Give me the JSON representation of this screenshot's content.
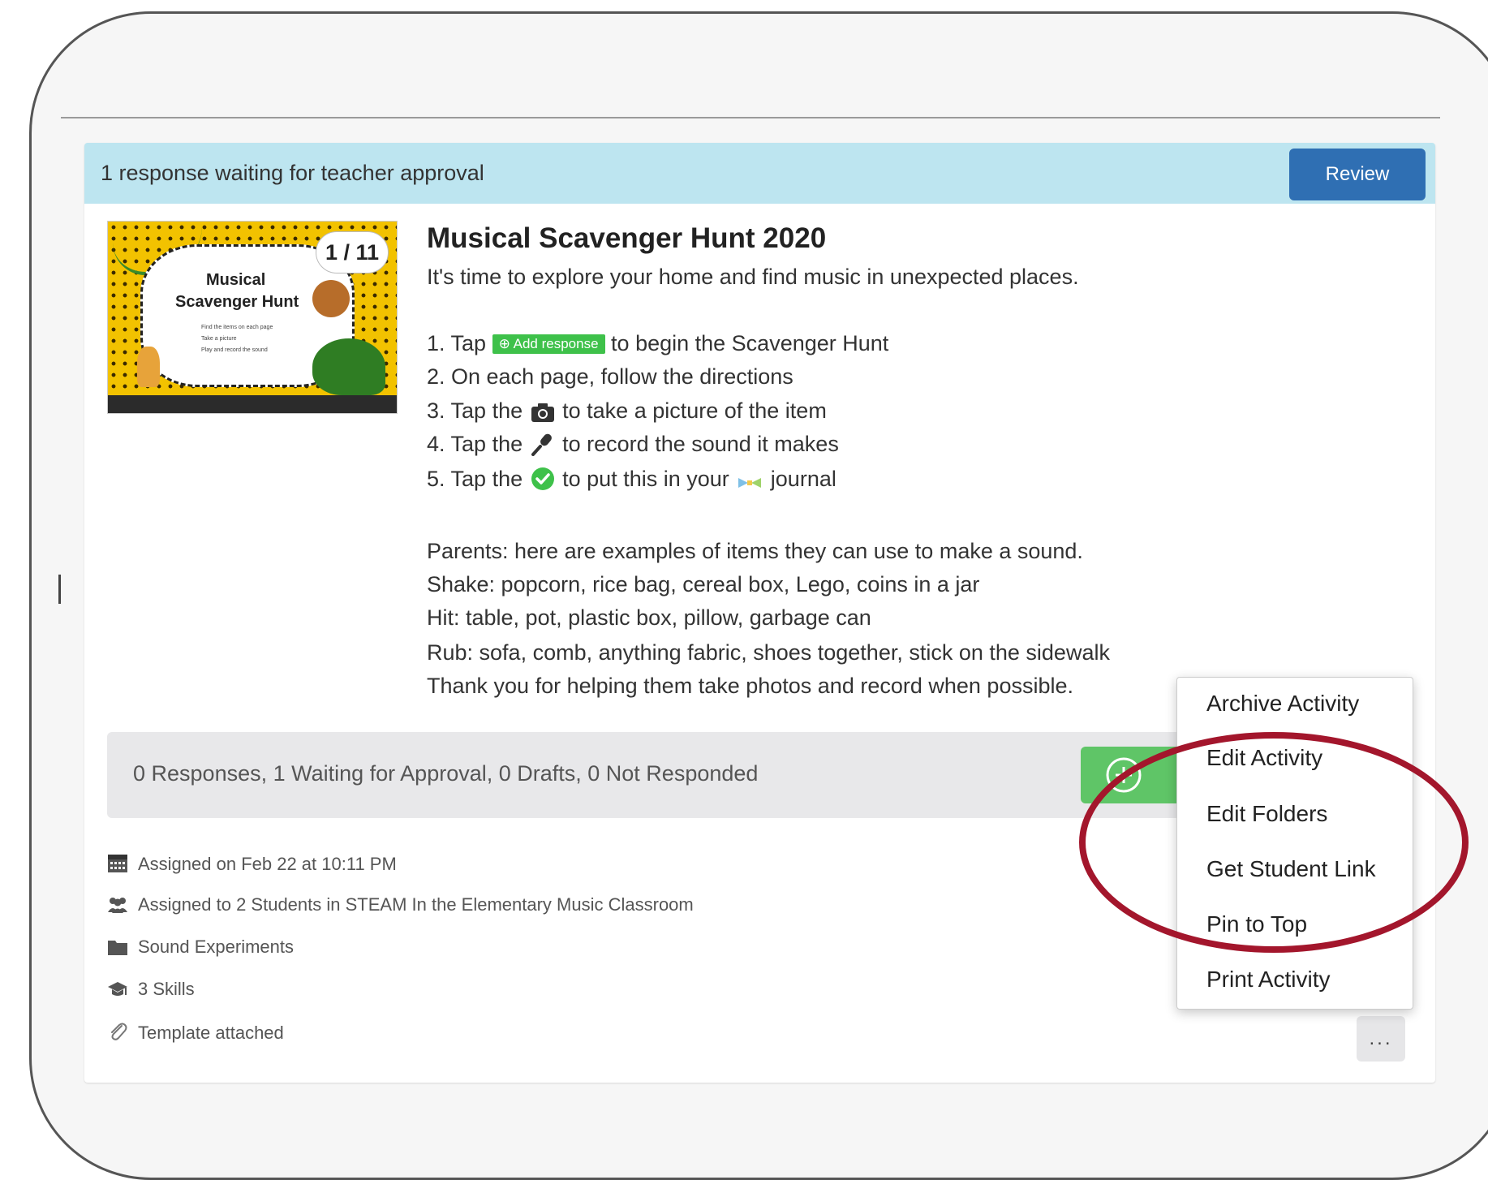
{
  "banner": {
    "text": "1 response waiting for teacher approval",
    "review_label": "Review"
  },
  "thumbnail": {
    "title_line1": "Musical",
    "title_line2": "Scavenger Hunt",
    "caption1": "Find the items on each page",
    "caption2": "Take a picture",
    "caption3": "Play and record the sound",
    "page_indicator": "1 / 11"
  },
  "activity": {
    "title": "Musical Scavenger Hunt 2020",
    "intro": "It's time to explore your home and find music in unexpected places.",
    "steps": {
      "s1_pre": "1. Tap",
      "s1_chip": "Add response",
      "s1_post": "to begin the Scavenger Hunt",
      "s2": "2. On each page, follow the directions",
      "s3_pre": "3. Tap the",
      "s3_post": "to take a picture of the item",
      "s4_pre": "4. Tap the",
      "s4_post": "to record the sound it makes",
      "s5_pre": "5. Tap the",
      "s5_mid": "to put this in your",
      "s5_post": "journal"
    },
    "parents": {
      "p1": "Parents: here are examples of items they can use to make a sound.",
      "p2": "Shake: popcorn, rice bag, cereal box, Lego, coins in a jar",
      "p3": "Hit: table, pot, plastic box, pillow, garbage can",
      "p4": "Rub: sofa, comb, anything fabric, shoes together, stick on the sidewalk",
      "p5": "Thank you for helping them take photos and record when possible."
    }
  },
  "stats": {
    "text": "0 Responses, 1 Waiting for Approval, 0 Drafts, 0 Not Responded"
  },
  "meta": {
    "assigned_on": "Assigned on Feb 22 at 10:11 PM",
    "assigned_to": "Assigned to 2 Students in STEAM In the Elementary Music Classroom",
    "folder": "Sound Experiments",
    "skills": "3 Skills",
    "template": "Template attached"
  },
  "menu": {
    "items": [
      "Archive Activity",
      "Edit Activity",
      "Edit Folders",
      "Get Student Link",
      "Pin to Top",
      "Print Activity"
    ],
    "more_label": "..."
  },
  "colors": {
    "banner_bg": "#bde5f0",
    "review_button": "#2f6fb3",
    "add_response_green": "#3ec14a",
    "highlight_circle": "#a3162c"
  }
}
